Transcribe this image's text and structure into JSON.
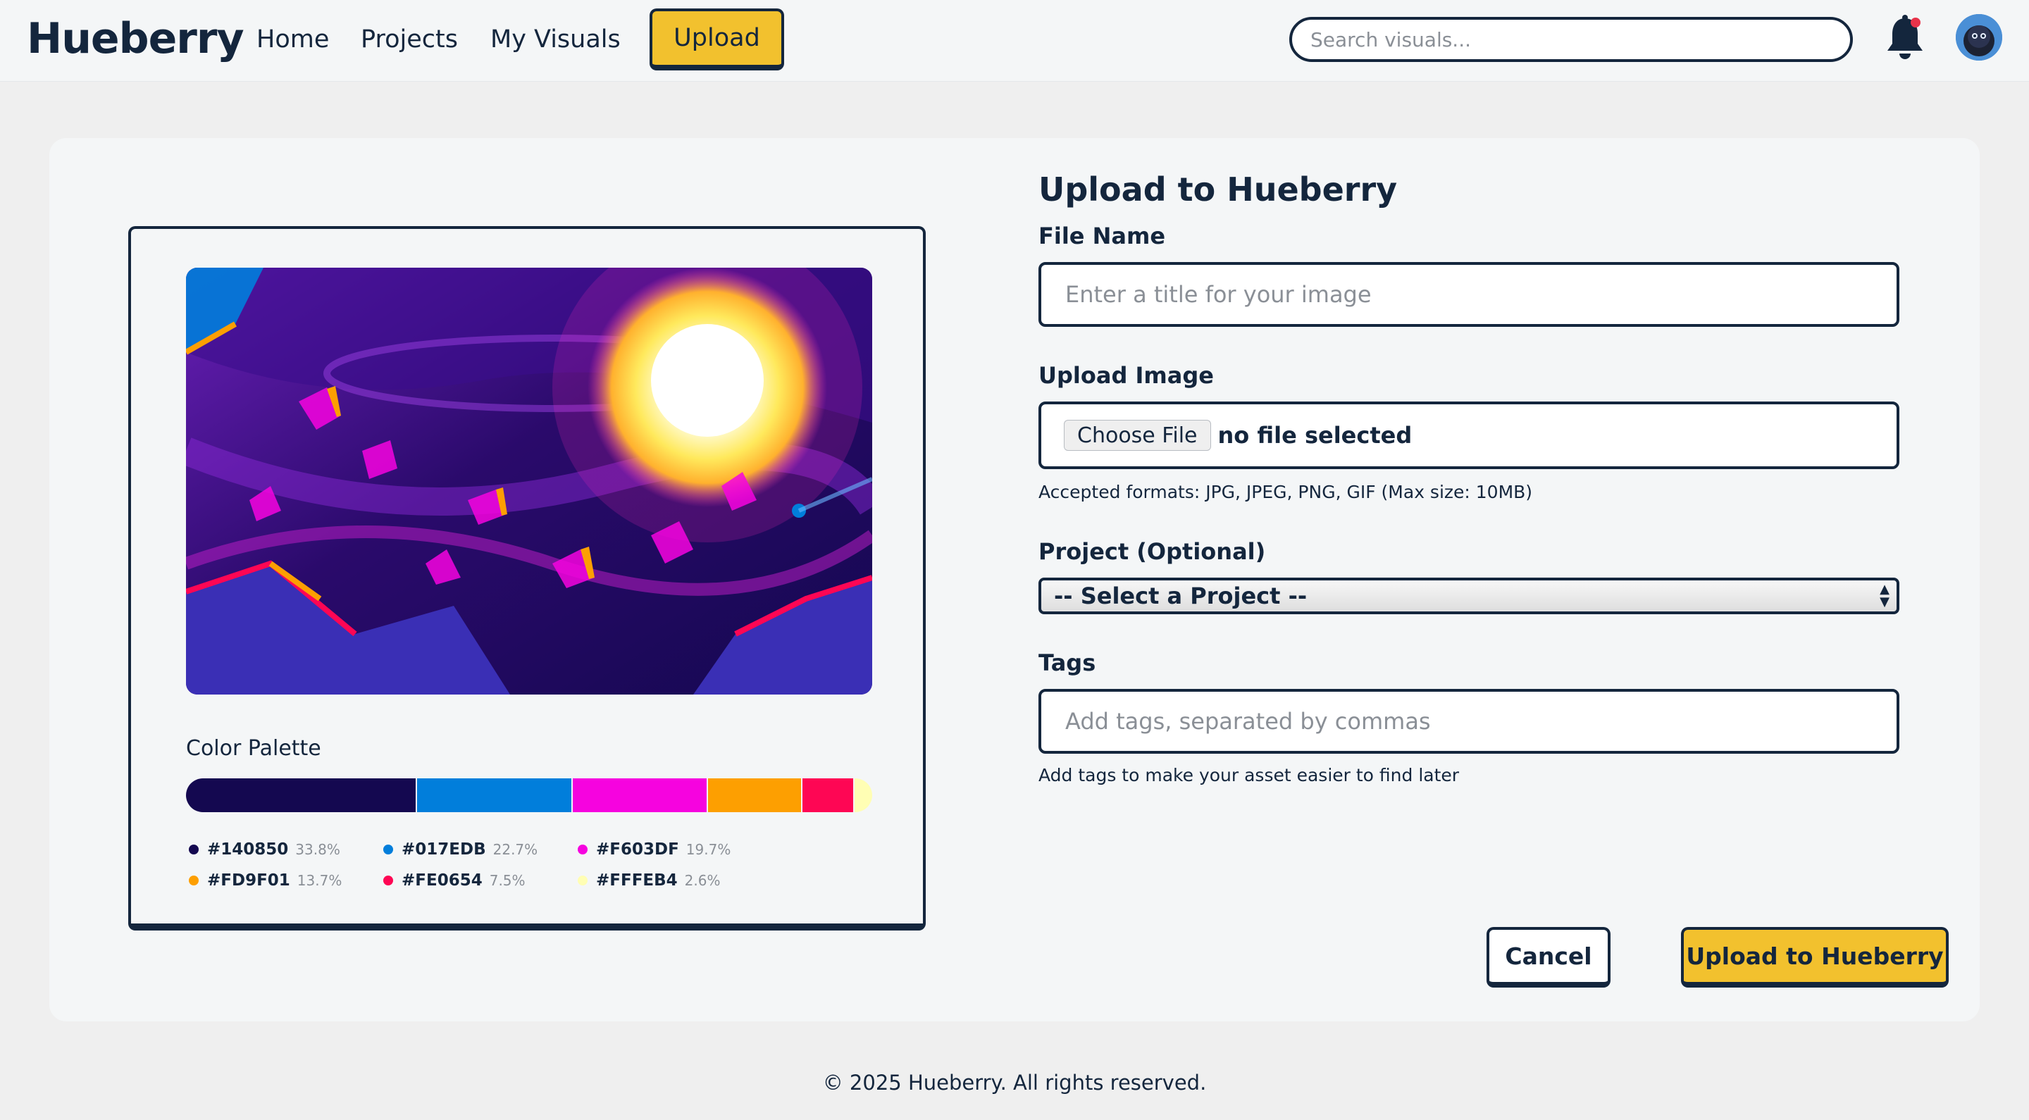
{
  "nav": {
    "logo": "Hueberry",
    "links": [
      "Home",
      "Projects",
      "My Visuals"
    ],
    "upload_label": "Upload",
    "search_placeholder": "Search visuals...",
    "notification_icon": "bell-icon",
    "has_notification": true
  },
  "preview": {
    "palette_title": "Color Palette",
    "palette": [
      {
        "hex": "#140850",
        "pct": "33.8%",
        "value": 33.8
      },
      {
        "hex": "#017EDB",
        "pct": "22.7%",
        "value": 22.7
      },
      {
        "hex": "#F603DF",
        "pct": "19.7%",
        "value": 19.7
      },
      {
        "hex": "#FD9F01",
        "pct": "13.7%",
        "value": 13.7
      },
      {
        "hex": "#FE0654",
        "pct": "7.5%",
        "value": 7.5
      },
      {
        "hex": "#FFFEB4",
        "pct": "2.6%",
        "value": 2.6
      }
    ]
  },
  "form": {
    "title": "Upload to Hueberry",
    "file_name_label": "File Name",
    "file_name_placeholder": "Enter a title for your image",
    "upload_image_label": "Upload Image",
    "choose_file_label": "Choose File",
    "file_status": "no file selected",
    "formats_help": "Accepted formats: JPG, JPEG, PNG, GIF (Max size: 10MB)",
    "project_label": "Project (Optional)",
    "project_selected": "-- Select a Project --",
    "tags_label": "Tags",
    "tags_placeholder": "Add tags, separated by commas",
    "tags_help": "Add tags to make your asset easier to find later",
    "cancel_label": "Cancel",
    "submit_label": "Upload to Hueberry"
  },
  "footer": {
    "copyright": "© 2025 Hueberry. All rights reserved."
  },
  "colors": {
    "accent": "#F2C12E",
    "ink": "#14263D",
    "background": "#EFEFEF",
    "card": "#F4F6F7"
  }
}
